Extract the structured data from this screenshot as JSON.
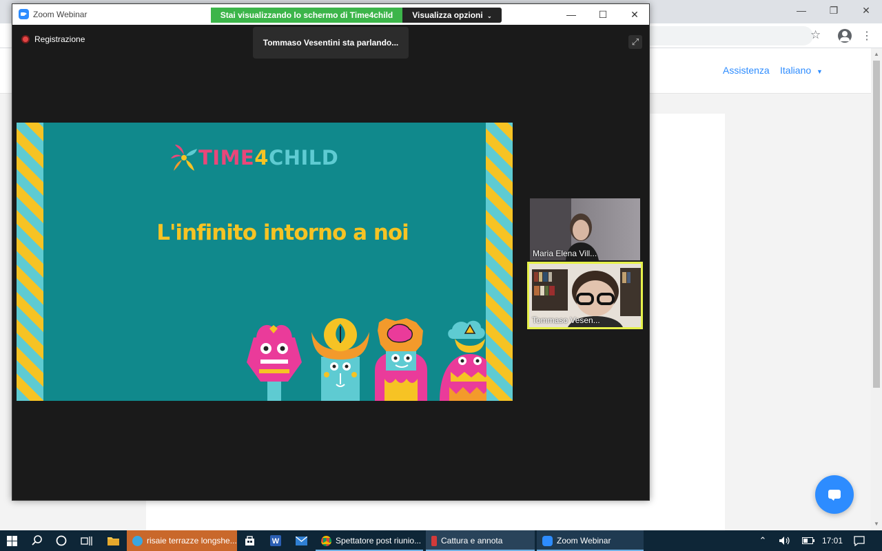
{
  "browser": {
    "nav_links": {
      "help": "Assistenza",
      "language": "Italiano"
    }
  },
  "zoom": {
    "window_title": "Zoom Webinar",
    "share_banner": {
      "status_text": "Stai visualizzando lo schermo di Time4child",
      "options_label": "Visualizza opzioni"
    },
    "recording_label": "Registrazione",
    "active_speaker_text": "Tommaso Vesentini sta parlando...",
    "slide": {
      "brand_part1": "TIME",
      "brand_digit": "4",
      "brand_part2": "CHILD",
      "headline": "L'infinito intorno a noi"
    },
    "participants": [
      {
        "name": "Maria Elena Vill..."
      },
      {
        "name": "Tommaso Vesen..."
      }
    ],
    "active_speaker_color": "#e6f14a"
  },
  "taskbar": {
    "tasks": [
      {
        "label": "risaie terrazze longshe...",
        "icon": "edge-icon",
        "color": "#c9682b"
      },
      {
        "label": "Spettatore post riunio...",
        "icon": "chrome-icon"
      },
      {
        "label": "Cattura e annota",
        "icon": "snip-icon"
      },
      {
        "label": "Zoom Webinar",
        "icon": "zoom-icon"
      }
    ],
    "clock": "17:01"
  }
}
